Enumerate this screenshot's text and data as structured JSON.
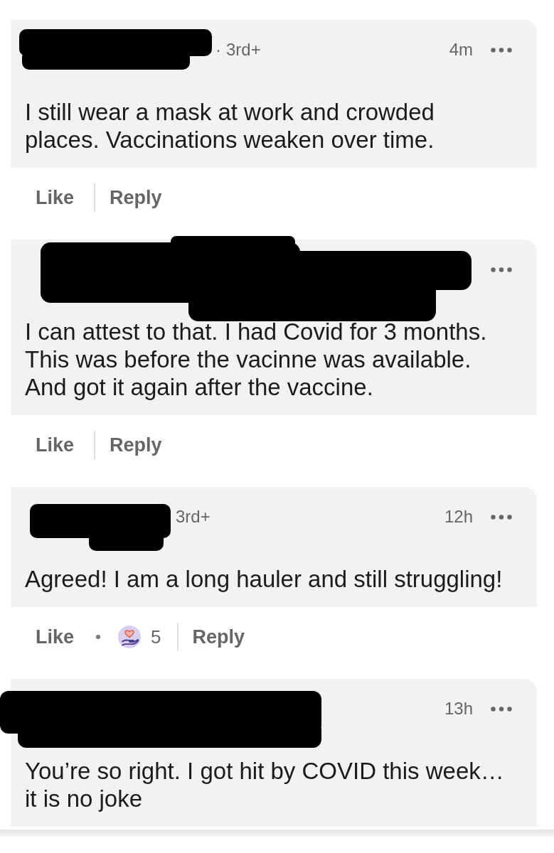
{
  "comments": [
    {
      "author_redacted": true,
      "separator": "·",
      "degree": "3rd+",
      "time": "4m",
      "text": "I still wear a mask at work and crowded places. Vaccinations weaken over time.",
      "like": "Like",
      "reply": "Reply"
    },
    {
      "author_redacted": true,
      "text": "I can attest to that. I had Covid for 3 months. This was before the vacinne was available. And got it again after the vaccine.",
      "like": "Like",
      "reply": "Reply"
    },
    {
      "author_redacted": true,
      "degree": "3rd+",
      "time": "12h",
      "text": "Agreed! I am a long hauler and still struggling!",
      "like": "Like",
      "reactions": {
        "count": "5"
      },
      "reply": "Reply"
    },
    {
      "author_redacted": true,
      "time": "13h",
      "text": "You’re so right. I got hit by COVID this week… it is no joke"
    }
  ]
}
